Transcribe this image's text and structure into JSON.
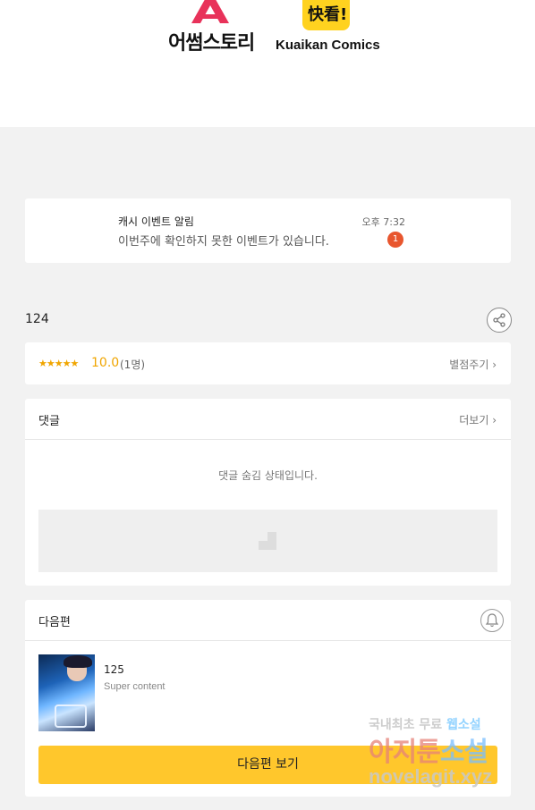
{
  "banner": {
    "logo1_text": "어썸스토리",
    "logo2_mark": "快看!",
    "logo2_text": "Kuaikan Comics"
  },
  "notification": {
    "title": "캐시 이벤트 알림",
    "message": "이번주에 확인하지 못한 이벤트가 있습니다.",
    "time": "오후 7:32",
    "badge": "1"
  },
  "episode": {
    "number": "124"
  },
  "rating": {
    "stars": "★★★★★",
    "score": "10.0",
    "count": "(1명)",
    "rate_link": "별점주기 ›"
  },
  "comments": {
    "label": "댓글",
    "more": "더보기 ›",
    "hidden_message": "댓글 숨김 상태입니다."
  },
  "next_episode": {
    "label": "다음편",
    "title": "125",
    "subtitle": "Super content",
    "button": "다음편 보기"
  },
  "watermark": {
    "line1_a": "국내최초 무료",
    "line1_b": "웹소설",
    "line2_a": "아지툰",
    "line2_b": "소설",
    "line3": "novelagit.xyz"
  },
  "colors": {
    "accent": "#ffc72c",
    "rating": "#f0a500",
    "badge": "#e8562e"
  },
  "icons": [
    "share-icon",
    "bell-icon",
    "chevron-right-icon"
  ]
}
